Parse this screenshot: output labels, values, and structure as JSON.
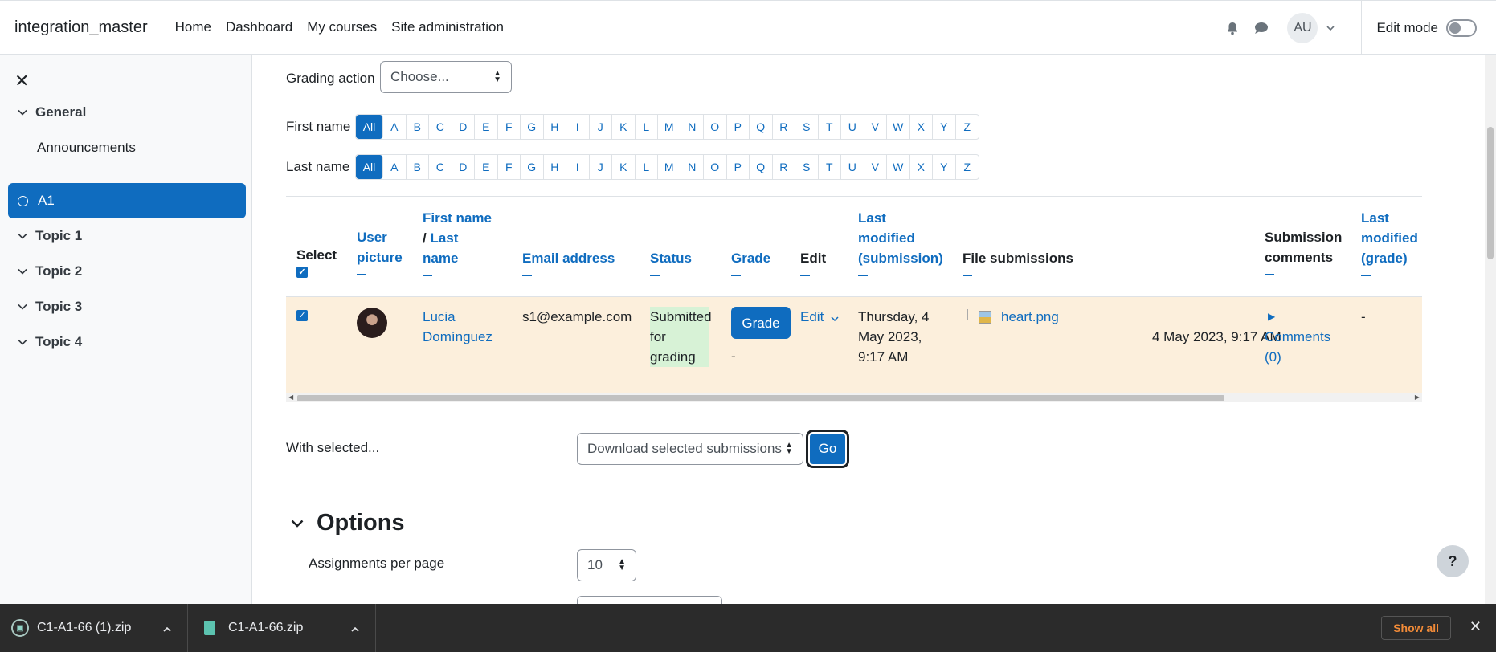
{
  "navbar": {
    "site_name": "integration_master",
    "links": [
      "Home",
      "Dashboard",
      "My courses",
      "Site administration"
    ],
    "avatar_initials": "AU",
    "edit_mode_label": "Edit mode",
    "edit_mode_on": false
  },
  "drawer": {
    "items": [
      {
        "label": "General",
        "type": "section"
      },
      {
        "label": "Announcements",
        "type": "activity"
      },
      {
        "label": "A1",
        "type": "activity-active"
      },
      {
        "label": "Topic 1",
        "type": "section"
      },
      {
        "label": "Topic 2",
        "type": "section"
      },
      {
        "label": "Topic 3",
        "type": "section"
      },
      {
        "label": "Topic 4",
        "type": "section"
      }
    ]
  },
  "grading_action": {
    "label": "Grading action",
    "selected": "Choose..."
  },
  "initials_filter": {
    "first_name_label": "First name",
    "last_name_label": "Last name",
    "letters": [
      "All",
      "A",
      "B",
      "C",
      "D",
      "E",
      "F",
      "G",
      "H",
      "I",
      "J",
      "K",
      "L",
      "M",
      "N",
      "O",
      "P",
      "Q",
      "R",
      "S",
      "T",
      "U",
      "V",
      "W",
      "X",
      "Y",
      "Z"
    ]
  },
  "table": {
    "headers": {
      "select": "Select",
      "user_picture_1": "User",
      "user_picture_2": "picture",
      "first_name": "First name",
      "slash": "/ ",
      "last_name_1": "Last",
      "last_name_2": "name",
      "email": "Email address",
      "status": "Status",
      "grade": "Grade",
      "edit": "Edit",
      "last_mod_sub_1": "Last",
      "last_mod_sub_2": "modified",
      "last_mod_sub_3": "(submission)",
      "file_submissions": "File submissions",
      "sub_comments_1": "Submission",
      "sub_comments_2": "comments",
      "last_mod_grade_1": "Last",
      "last_mod_grade_2": "modified",
      "last_mod_grade_3": "(grade)"
    },
    "row": {
      "selected": true,
      "first_name": "Lucia",
      "last_name": "Domínguez",
      "email": "s1@example.com",
      "status_1": "Submitted",
      "status_2": "for",
      "status_3": "grading",
      "grade_button": "Grade",
      "grade_value": "-",
      "edit_label": "Edit",
      "last_modified_1": "Thursday, 4",
      "last_modified_2": "May 2023,",
      "last_modified_3": "9:17 AM",
      "file_name": "heart.png",
      "file_date": "4 May 2023, 9:17 AM",
      "comments_1": "Comments",
      "comments_2": "(0)",
      "last_modified_grade": "-"
    }
  },
  "with_selected": {
    "label": "With selected...",
    "selected": "Download selected submissions",
    "go_label": "Go"
  },
  "options": {
    "title": "Options",
    "per_page_label": "Assignments per page",
    "per_page_value": "10"
  },
  "help_label": "?",
  "downloads": {
    "files": [
      "C1-A1-66 (1).zip",
      "C1-A1-66.zip"
    ],
    "show_all": "Show all"
  }
}
